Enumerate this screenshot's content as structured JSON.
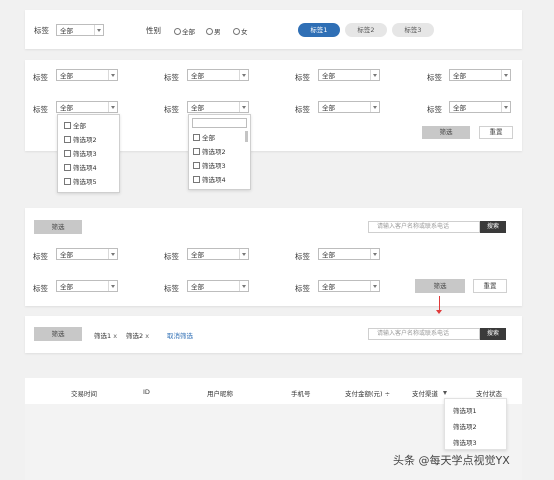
{
  "s1": {
    "label": "标签",
    "select_value": "全部",
    "gender_label": "性别",
    "radios": [
      "全部",
      "男",
      "女"
    ],
    "pills": [
      "标签1",
      "标签2",
      "标签3"
    ],
    "colors": {
      "active_pill": "#2f6fb5",
      "inactive_pill": "#e6e6e6"
    }
  },
  "s2": {
    "label": "标签",
    "select_value": "全部",
    "dropdown_a": [
      "全部",
      "筛选项2",
      "筛选项3",
      "筛选项4",
      "筛选项5"
    ],
    "dropdown_b": [
      "全部",
      "筛选项2",
      "筛选项3",
      "筛选项4"
    ],
    "filter_button": "筛选",
    "reset_button": "重置"
  },
  "s3": {
    "top_button": "筛选",
    "search_placeholder": "请输入客户名称或联系电话",
    "search_button": "搜索",
    "label": "标签",
    "select_value": "全部",
    "filter_button": "筛选",
    "reset_button": "重置"
  },
  "s4": {
    "button": "筛选",
    "chips": [
      "筛选1",
      "筛选2"
    ],
    "chip_close": "x",
    "cancel_link": "取消筛选",
    "search_placeholder": "请输入客户名称或联系电话",
    "search_button": "搜索",
    "colors": {
      "link": "#2f6fb5",
      "arrow": "#e03a3a"
    }
  },
  "table": {
    "headers": [
      "交易时间",
      "ID",
      "用户昵称",
      "手机号",
      "支付金额(元) ÷",
      "支付渠道",
      "支付状态"
    ],
    "sort_icon": "filter-triangle-icon",
    "dropdown": [
      "筛选项1",
      "筛选项2",
      "筛选项3"
    ]
  },
  "watermark": "头条 @每天学点视觉YX"
}
